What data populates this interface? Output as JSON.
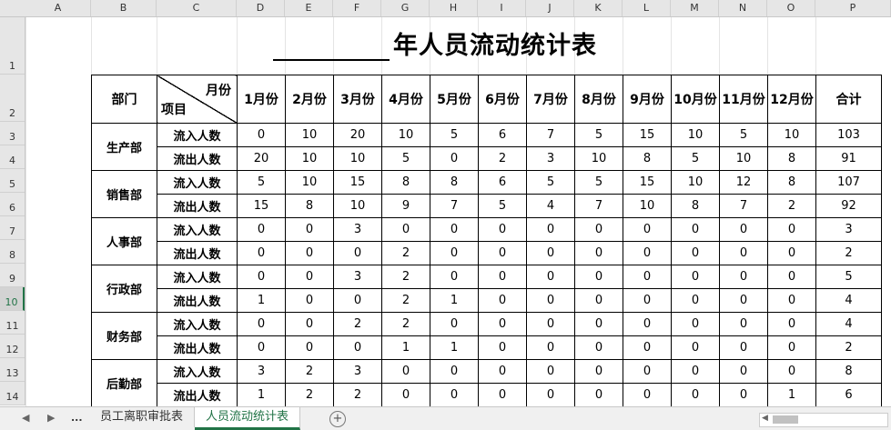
{
  "columns": [
    "A",
    "B",
    "C",
    "D",
    "E",
    "F",
    "G",
    "H",
    "I",
    "J",
    "K",
    "L",
    "M",
    "N",
    "O",
    "P"
  ],
  "rows": [
    "1",
    "2",
    "3",
    "4",
    "5",
    "6",
    "7",
    "8",
    "9",
    "10",
    "11",
    "12",
    "13",
    "14"
  ],
  "selected_row": "10",
  "title": {
    "blank": "",
    "text": "年人员流动统计表"
  },
  "header": {
    "dept": "部门",
    "month_label": "月份",
    "item_label": "项目",
    "months": [
      "1月份",
      "2月份",
      "3月份",
      "4月份",
      "5月份",
      "6月份",
      "7月份",
      "8月份",
      "9月份",
      "10月份",
      "11月份",
      "12月份"
    ],
    "total": "合计"
  },
  "departments": [
    {
      "name": "生产部",
      "rows": [
        {
          "type": "流入人数",
          "values": [
            "0",
            "10",
            "20",
            "10",
            "5",
            "6",
            "7",
            "5",
            "15",
            "10",
            "5",
            "10"
          ],
          "total": "103"
        },
        {
          "type": "流出人数",
          "values": [
            "20",
            "10",
            "10",
            "5",
            "0",
            "2",
            "3",
            "10",
            "8",
            "5",
            "10",
            "8"
          ],
          "total": "91"
        }
      ]
    },
    {
      "name": "销售部",
      "rows": [
        {
          "type": "流入人数",
          "values": [
            "5",
            "10",
            "15",
            "8",
            "8",
            "6",
            "5",
            "5",
            "15",
            "10",
            "12",
            "8"
          ],
          "total": "107"
        },
        {
          "type": "流出人数",
          "values": [
            "15",
            "8",
            "10",
            "9",
            "7",
            "5",
            "4",
            "7",
            "10",
            "8",
            "7",
            "2"
          ],
          "total": "92"
        }
      ]
    },
    {
      "name": "人事部",
      "rows": [
        {
          "type": "流入人数",
          "values": [
            "0",
            "0",
            "3",
            "0",
            "0",
            "0",
            "0",
            "0",
            "0",
            "0",
            "0",
            "0"
          ],
          "total": "3"
        },
        {
          "type": "流出人数",
          "values": [
            "0",
            "0",
            "0",
            "2",
            "0",
            "0",
            "0",
            "0",
            "0",
            "0",
            "0",
            "0"
          ],
          "total": "2"
        }
      ]
    },
    {
      "name": "行政部",
      "rows": [
        {
          "type": "流入人数",
          "values": [
            "0",
            "0",
            "3",
            "2",
            "0",
            "0",
            "0",
            "0",
            "0",
            "0",
            "0",
            "0"
          ],
          "total": "5"
        },
        {
          "type": "流出人数",
          "values": [
            "1",
            "0",
            "0",
            "2",
            "1",
            "0",
            "0",
            "0",
            "0",
            "0",
            "0",
            "0"
          ],
          "total": "4"
        }
      ]
    },
    {
      "name": "财务部",
      "rows": [
        {
          "type": "流入人数",
          "values": [
            "0",
            "0",
            "2",
            "2",
            "0",
            "0",
            "0",
            "0",
            "0",
            "0",
            "0",
            "0"
          ],
          "total": "4"
        },
        {
          "type": "流出人数",
          "values": [
            "0",
            "0",
            "0",
            "1",
            "1",
            "0",
            "0",
            "0",
            "0",
            "0",
            "0",
            "0"
          ],
          "total": "2"
        }
      ]
    },
    {
      "name": "后勤部",
      "rows": [
        {
          "type": "流入人数",
          "values": [
            "3",
            "2",
            "3",
            "0",
            "0",
            "0",
            "0",
            "0",
            "0",
            "0",
            "0",
            "0"
          ],
          "total": "8"
        },
        {
          "type": "流出人数",
          "values": [
            "1",
            "2",
            "2",
            "0",
            "0",
            "0",
            "0",
            "0",
            "0",
            "0",
            "0",
            "1"
          ],
          "total": "6"
        }
      ]
    }
  ],
  "sheet_tabs": {
    "nav_prev": "◀",
    "nav_next": "▶",
    "more": "...",
    "tabs": [
      "员工离职审批表",
      "人员流动统计表"
    ],
    "active": 1,
    "add": "+"
  },
  "accent_color": "#217346"
}
